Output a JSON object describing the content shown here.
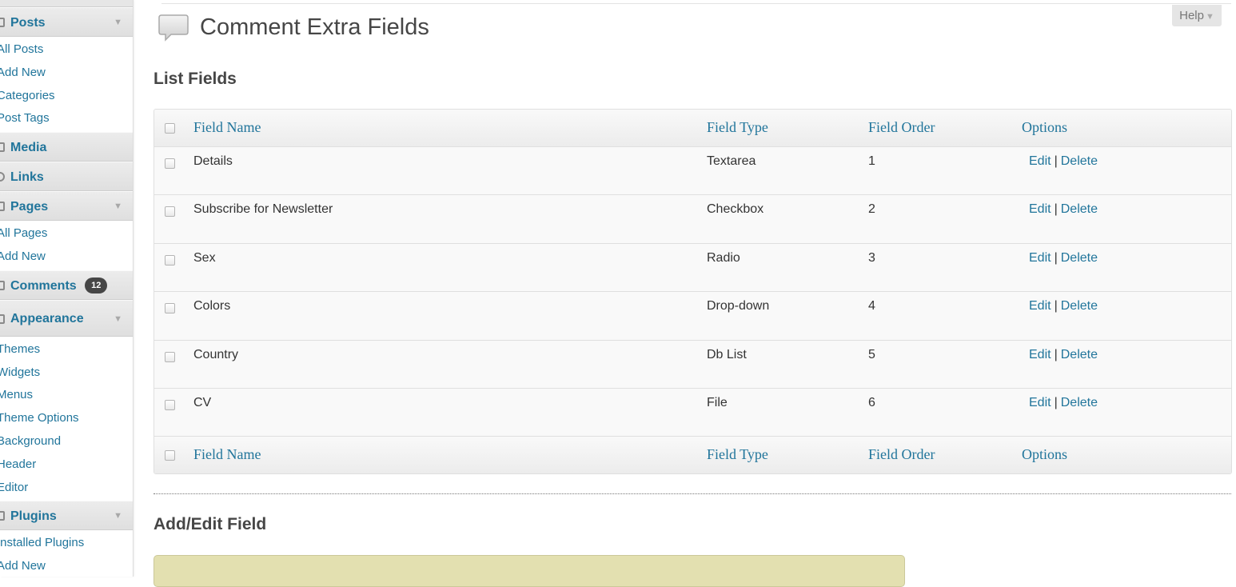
{
  "sidebar": {
    "posts": {
      "label": "Posts",
      "items": [
        "All Posts",
        "Add New",
        "Categories",
        "Post Tags"
      ]
    },
    "media": {
      "label": "Media"
    },
    "links": {
      "label": "Links"
    },
    "pages": {
      "label": "Pages",
      "items": [
        "All Pages",
        "Add New"
      ]
    },
    "comments": {
      "label": "Comments",
      "badge": "12"
    },
    "appearance": {
      "label": "Appearance",
      "items": [
        "Themes",
        "Widgets",
        "Menus",
        "Theme Options",
        "Background",
        "Header",
        "Editor"
      ]
    },
    "plugins": {
      "label": "Plugins",
      "items": [
        "Installed Plugins",
        "Add New"
      ]
    }
  },
  "header": {
    "title": "Comment Extra Fields",
    "help_label": "Help"
  },
  "list": {
    "title": "List Fields",
    "columns": {
      "name": "Field Name",
      "type": "Field Type",
      "order": "Field Order",
      "options": "Options"
    },
    "rows": [
      {
        "name": "Details",
        "type": "Textarea",
        "order": "1"
      },
      {
        "name": "Subscribe for Newsletter",
        "type": "Checkbox",
        "order": "2"
      },
      {
        "name": "Sex",
        "type": "Radio",
        "order": "3"
      },
      {
        "name": "Colors",
        "type": "Drop-down",
        "order": "4"
      },
      {
        "name": "Country",
        "type": "Db List",
        "order": "5"
      },
      {
        "name": "CV",
        "type": "File",
        "order": "6"
      }
    ],
    "edit_label": "Edit",
    "separator": "|",
    "delete_label": "Delete"
  },
  "add_edit": {
    "title": "Add/Edit Field"
  },
  "colors": {
    "link": "#21759b",
    "heading": "#464646",
    "badge": "#464646",
    "notice_box": "#e3e0b0"
  }
}
